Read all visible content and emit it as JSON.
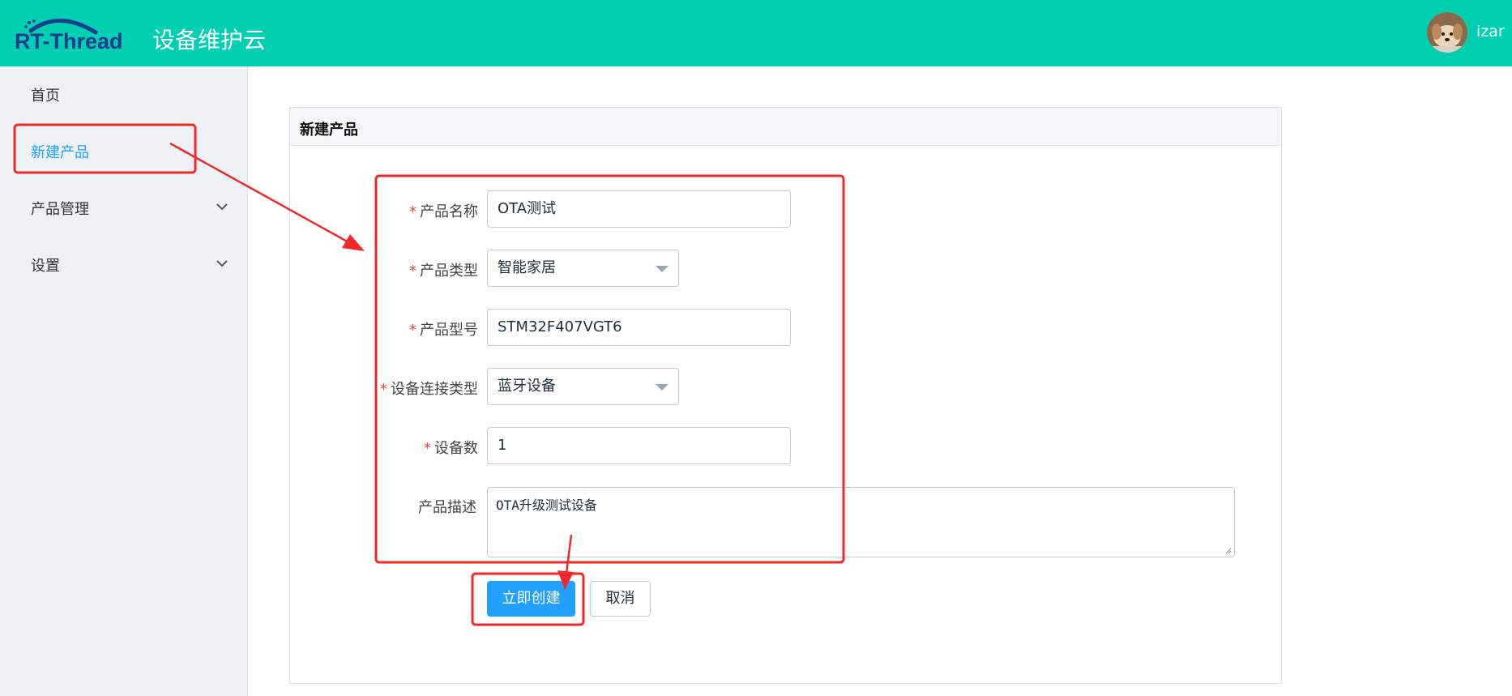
{
  "header": {
    "logo_text": "RT-Thread",
    "app_title": "设备维护云",
    "username": "izar",
    "background_color": "#00cfb1"
  },
  "sidebar": {
    "items": [
      {
        "label": "首页",
        "active": false,
        "expandable": false
      },
      {
        "label": "新建产品",
        "active": true,
        "expandable": false
      },
      {
        "label": "产品管理",
        "active": false,
        "expandable": true,
        "icon": "chevron-down-icon"
      },
      {
        "label": "设置",
        "active": false,
        "expandable": true,
        "icon": "chevron-down-icon"
      }
    ]
  },
  "card": {
    "title": "新建产品"
  },
  "form": {
    "required_mark": "*",
    "product_name": {
      "label": "产品名称",
      "value": "OTA测试",
      "required": true
    },
    "product_type": {
      "label": "产品类型",
      "value": "智能家居",
      "required": true
    },
    "product_model": {
      "label": "产品型号",
      "value": "STM32F407VGT6",
      "required": true
    },
    "connection_type": {
      "label": "设备连接类型",
      "value": "蓝牙设备",
      "required": true
    },
    "device_count": {
      "label": "设备数",
      "value": "1",
      "required": true
    },
    "description": {
      "label": "产品描述",
      "value": "OTA升级测试设备",
      "required": false
    },
    "submit_label": "立即创建",
    "cancel_label": "取消"
  },
  "colors": {
    "primary": "#20a0ff",
    "required": "#f04134",
    "annotation": "#f0282a"
  }
}
